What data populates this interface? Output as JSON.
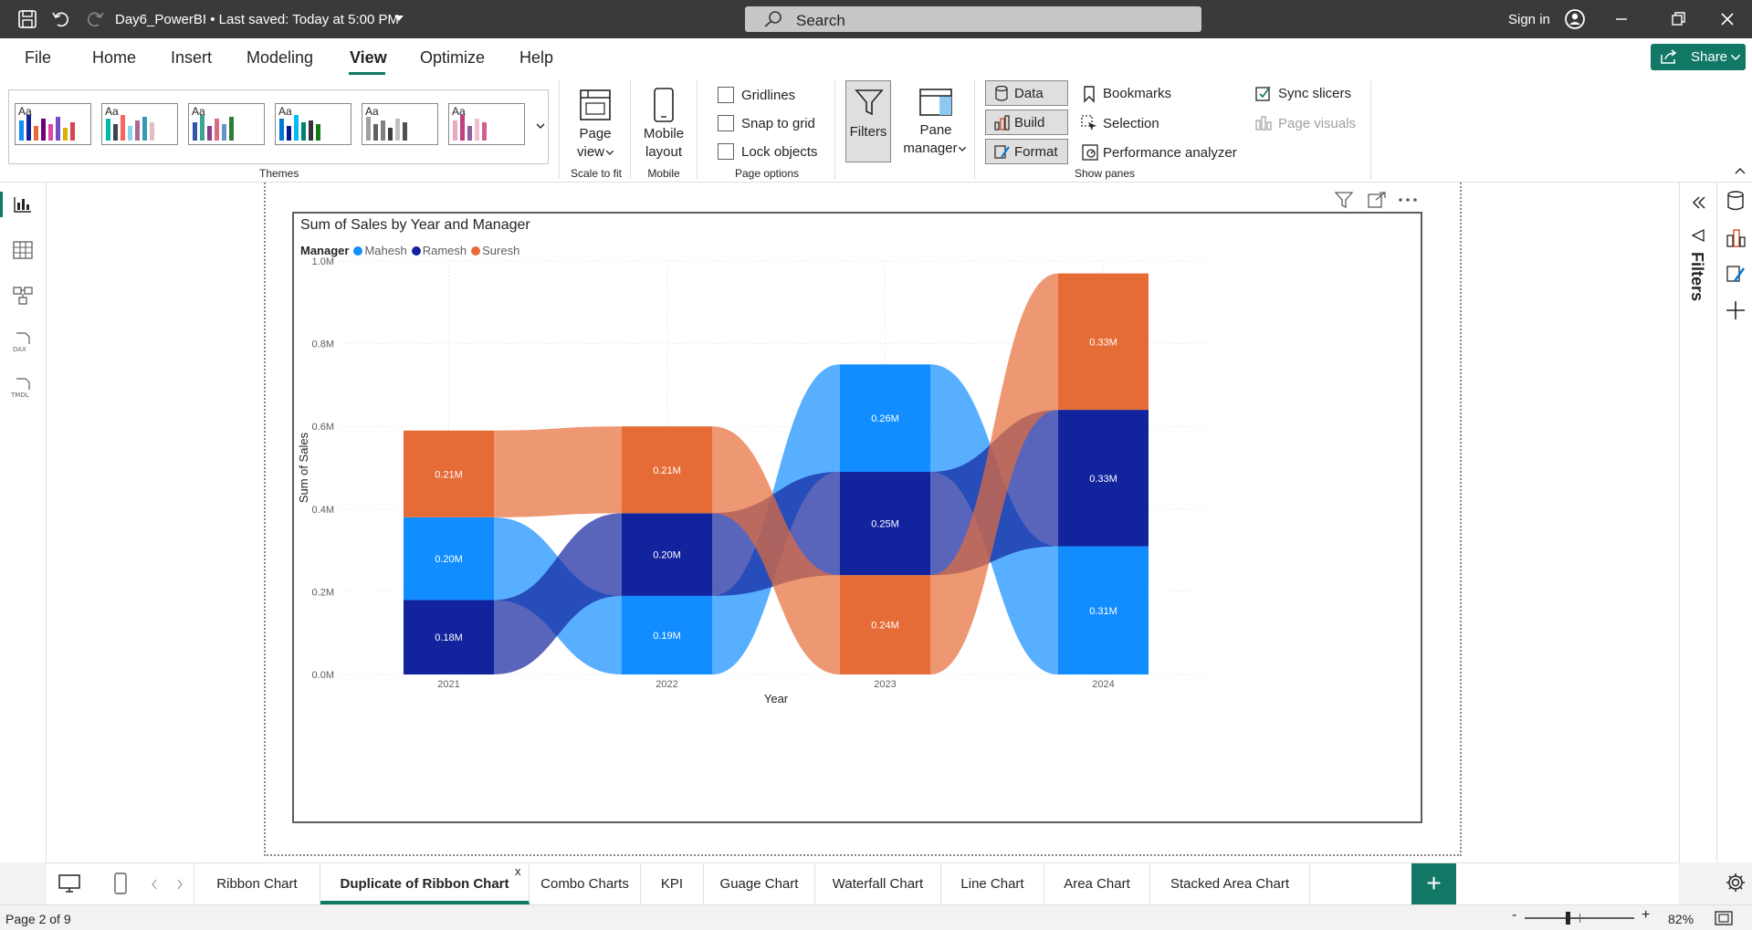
{
  "titlebar": {
    "doc_title": "Day6_PowerBI • Last saved: Today at 5:00 PM",
    "search_placeholder": "Search",
    "sign_in": "Sign in"
  },
  "menu": {
    "items": [
      "File",
      "Home",
      "Insert",
      "Modeling",
      "View",
      "Optimize",
      "Help"
    ],
    "active": "View",
    "share": "Share"
  },
  "ribbon": {
    "themes_label": "Themes",
    "page_view": [
      "Page",
      "view"
    ],
    "scale_to_fit": "Scale to fit",
    "mobile_layout": [
      "Mobile",
      "layout"
    ],
    "mobile_label": "Mobile",
    "gridlines": "Gridlines",
    "snap_to_grid": "Snap to grid",
    "lock_objects": "Lock objects",
    "page_options_label": "Page options",
    "filters": "Filters",
    "pane_manager": [
      "Pane",
      "manager"
    ],
    "data": "Data",
    "build": "Build",
    "format": "Format",
    "bookmarks": "Bookmarks",
    "selection": "Selection",
    "performance_analyzer": "Performance analyzer",
    "sync_slicers": "Sync slicers",
    "page_visuals": "Page visuals",
    "show_panes_label": "Show panes"
  },
  "right_pane": {
    "filters": "Filters"
  },
  "chart_data": {
    "type": "ribbon",
    "title": "Sum of Sales by Year and Manager",
    "legend_title": "Manager",
    "legend_position": "top-left",
    "categories": [
      "2021",
      "2022",
      "2023",
      "2024"
    ],
    "series": [
      {
        "name": "Mahesh",
        "color": "#118dff",
        "values": [
          0.2,
          0.19,
          0.26,
          0.31
        ]
      },
      {
        "name": "Ramesh",
        "color": "#12239e",
        "values": [
          0.18,
          0.2,
          0.25,
          0.33
        ]
      },
      {
        "name": "Suresh",
        "color": "#e66c37",
        "values": [
          0.21,
          0.21,
          0.24,
          0.33
        ]
      }
    ],
    "data_labels": [
      [
        "0.20M",
        "0.19M",
        "0.26M",
        "0.31M"
      ],
      [
        "0.18M",
        "0.20M",
        "0.25M",
        "0.33M"
      ],
      [
        "0.21M",
        "0.21M",
        "0.24M",
        "0.33M"
      ]
    ],
    "xlabel": "Year",
    "ylabel": "Sum of Sales",
    "yticks": [
      "0.0M",
      "0.2M",
      "0.4M",
      "0.6M",
      "0.8M",
      "1.0M"
    ],
    "ylim": [
      0,
      1.0
    ],
    "grid": true
  },
  "tabs": {
    "items": [
      "Ribbon Chart",
      "Duplicate of Ribbon Chart",
      "Combo Charts",
      "KPI",
      "Guage Chart",
      "Waterfall Chart",
      "Line Chart",
      "Area Chart",
      "Stacked Area Chart"
    ],
    "active": "Duplicate of Ribbon Chart",
    "close_mark": "x",
    "add": "+"
  },
  "status": {
    "page": "Page 2 of 9",
    "zoom": "82%"
  }
}
